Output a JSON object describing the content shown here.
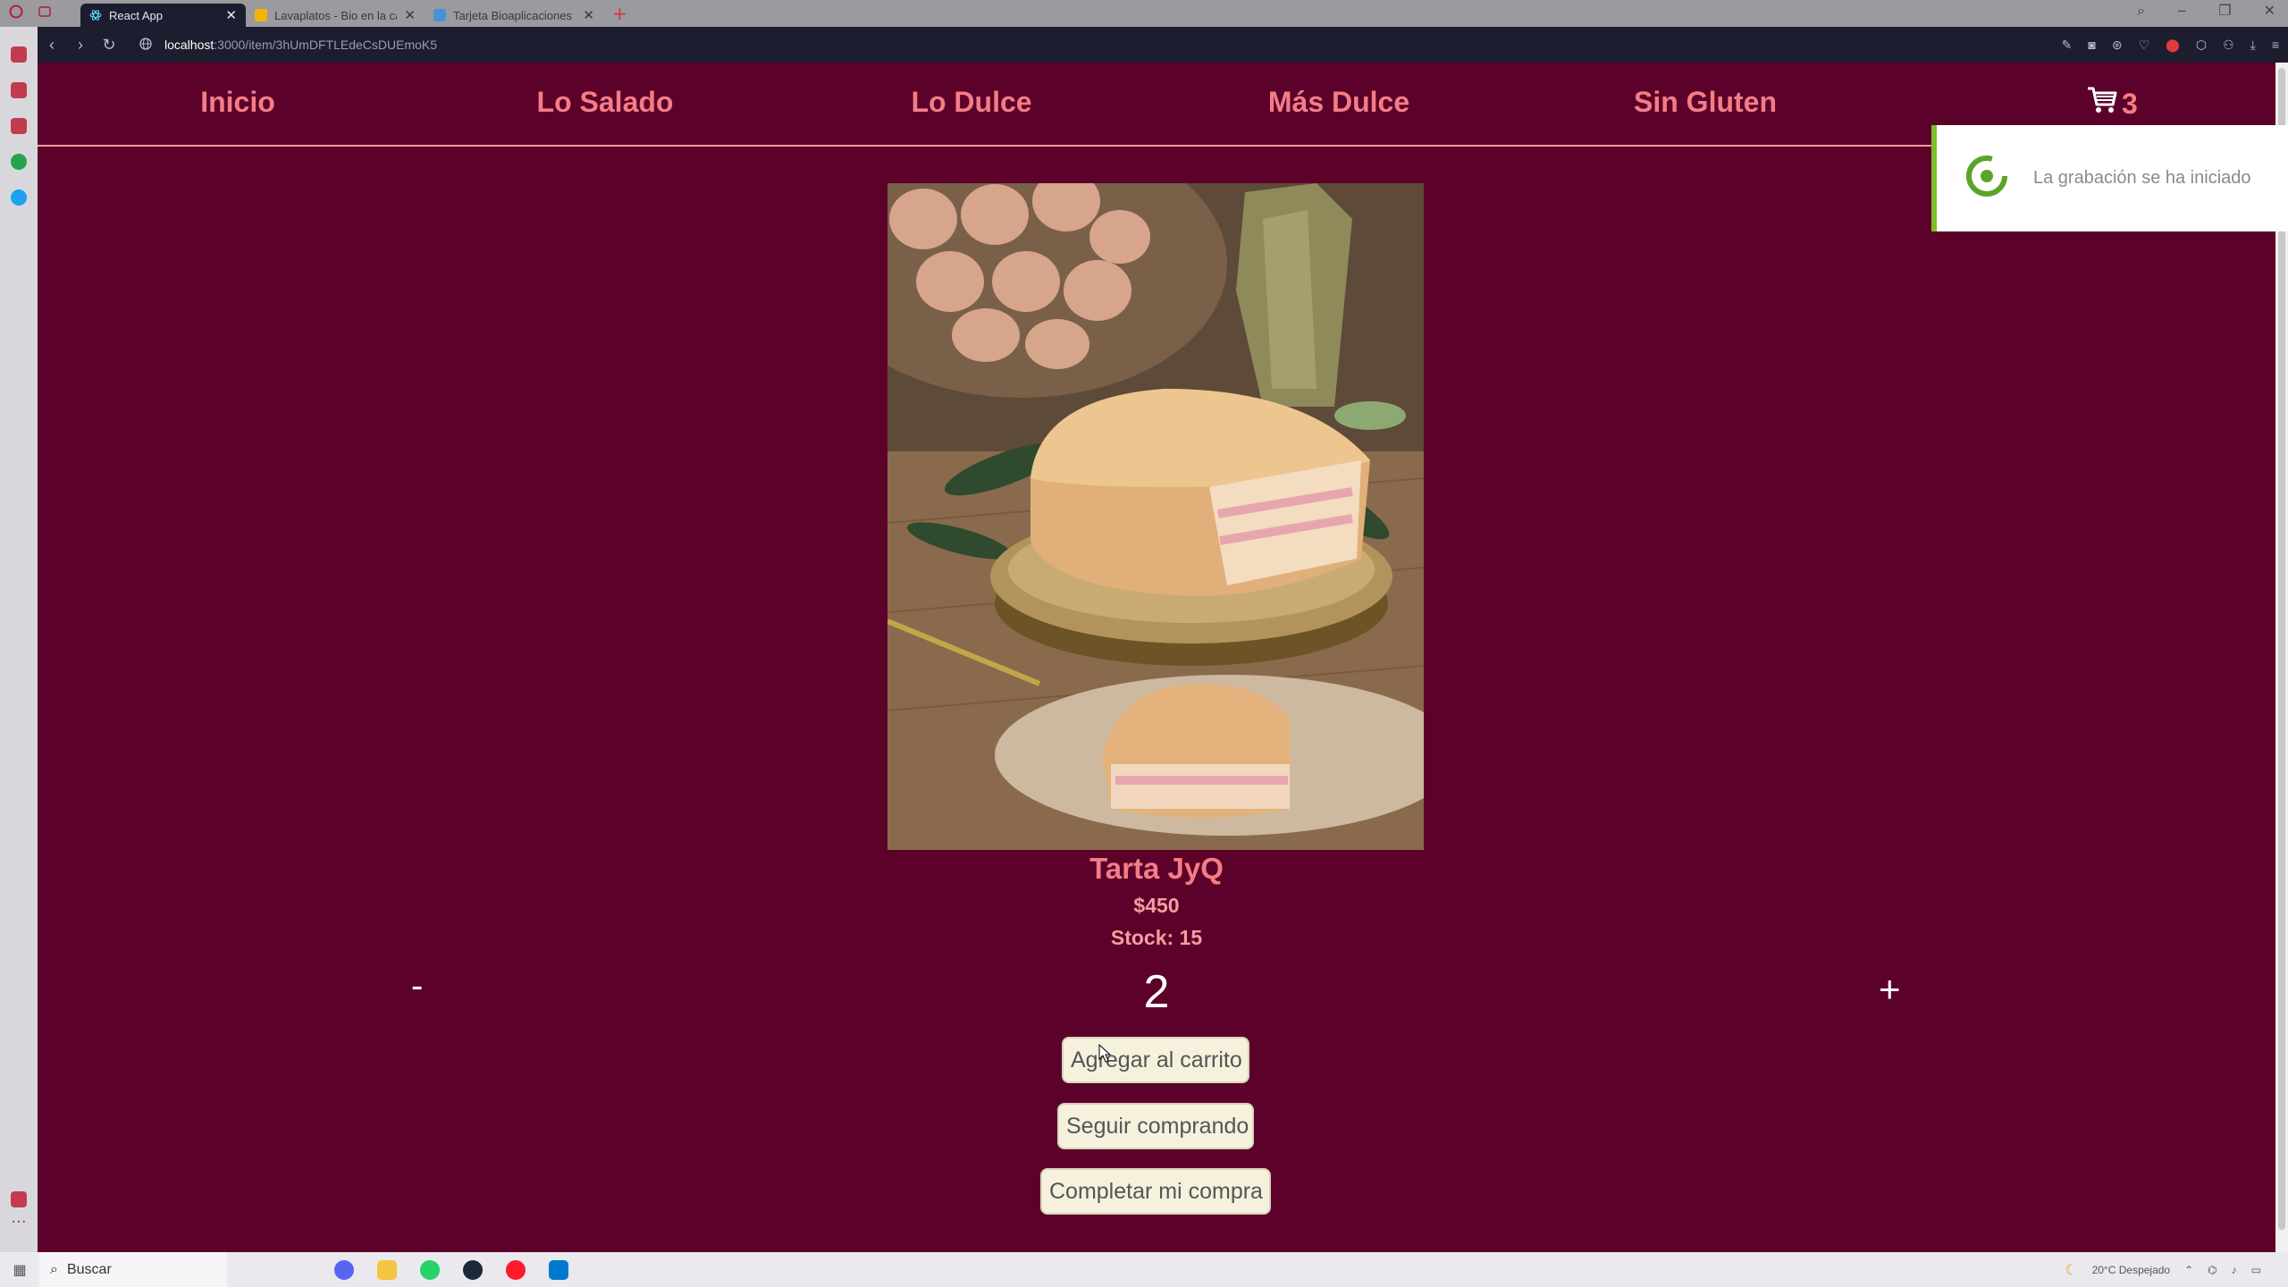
{
  "browser": {
    "tabs": [
      {
        "title": "React App",
        "active": true,
        "icon_color": "#61dafb"
      },
      {
        "title": "Lavaplatos - Bio en la casa - G",
        "active": false,
        "icon_color": "#f4b400"
      },
      {
        "title": "Tarjeta Bioaplicaciones - Asocia",
        "active": false,
        "icon_color": "#4a90d9"
      }
    ],
    "new_tab_symbol": "+",
    "url_host": "localhost",
    "url_path": ":3000/item/3hUmDFTLEdeCsDUEmoK5"
  },
  "nav": {
    "items": [
      "Inicio",
      "Lo Salado",
      "Lo Dulce",
      "Más Dulce",
      "Sin Gluten"
    ],
    "cart_count": "3"
  },
  "toast": {
    "text": "La grabación se ha iniciado"
  },
  "product": {
    "name": "Tarta JyQ",
    "price": "$450",
    "stock": "Stock: 15",
    "image_alt": "cake-photo"
  },
  "counter": {
    "minus": "-",
    "value": "2",
    "plus": "+"
  },
  "buttons": {
    "add_to_cart": "Agregar al carrito",
    "keep_shopping": "Seguir comprando",
    "checkout": "Completar mi compra"
  },
  "taskbar": {
    "search_placeholder": "Buscar",
    "weather": "20°C Despejado"
  },
  "colors": {
    "page_bg": "#5c0129",
    "nav_text": "#f37d87",
    "button_bg": "#f5f1dd",
    "toast_accent": "#7bbf2a"
  }
}
